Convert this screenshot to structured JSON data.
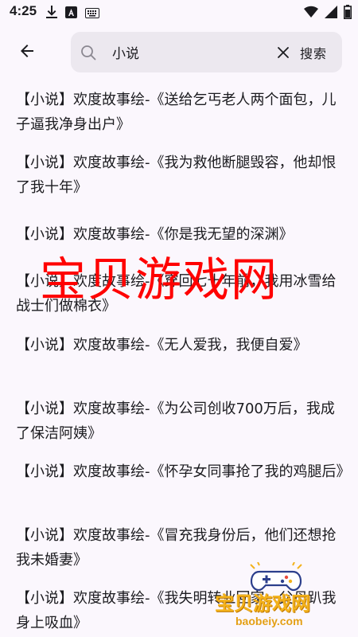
{
  "status_bar": {
    "time": "4:25",
    "icons_left": [
      "download-icon",
      "a-badge-icon",
      "keyboard-icon"
    ],
    "icons_right": [
      "wifi-icon",
      "signal-icon",
      "battery-icon"
    ]
  },
  "search": {
    "query": "小说",
    "button_label": "搜索"
  },
  "results": [
    {
      "text": "【小说】欢度故事绘-《送给乞丐老人两个面包，儿子逼我净身出户》"
    },
    {
      "text": "【小说】欢度故事绘-《我为救他断腿毁容，他却恨了我十年》"
    },
    {
      "text": "【小说】欢度故事绘-《你是我无望的深渊》"
    },
    {
      "text": "【小说】欢度故事绘-《穿回七十年前，我用冰雪给战士们做棉衣》"
    },
    {
      "text": "【小说】欢度故事绘-《无人爱我，我便自爱》"
    },
    {
      "text": "【小说】欢度故事绘-《为公司创收700万后，我成了保洁阿姨》"
    },
    {
      "text": "【小说】欢度故事绘-《怀孕女同事抢了我的鸡腿后》"
    },
    {
      "text": "【小说】欢度故事绘-《冒充我身份后，他们还想抢我未婚妻》"
    },
    {
      "text": "【小说】欢度故事绘-《我失明转业回家，父母趴我身上吸血》"
    }
  ],
  "watermark": {
    "main_text": "宝贝游戏网",
    "logo_text": "宝贝游戏网",
    "url": "baobeiy.com",
    "color_main": "#ff0000",
    "color_logo": "#f3b21b"
  }
}
